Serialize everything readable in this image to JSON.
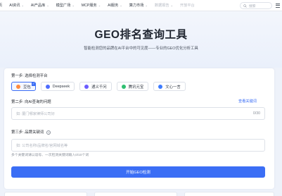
{
  "nav": {
    "items": [
      {
        "label": "页",
        "has_menu": false,
        "faded": false
      },
      {
        "label": "AI资讯",
        "has_menu": true,
        "faded": false
      },
      {
        "label": "AI产品库",
        "has_menu": true,
        "faded": false
      },
      {
        "label": "模型广场",
        "has_menu": true,
        "faded": false
      },
      {
        "label": "MCP服务",
        "has_menu": true,
        "faded": false
      },
      {
        "label": "AI服务",
        "has_menu": true,
        "faded": false
      },
      {
        "label": "算力市场",
        "has_menu": true,
        "faded": false
      },
      {
        "label": "数据报告",
        "has_menu": true,
        "faded": true
      },
      {
        "label": "开放平台",
        "has_menu": false,
        "faded": true
      }
    ],
    "search_placeholder": "搜索"
  },
  "hero": {
    "title": "GEO排名查询工具",
    "subtitle": "智能检测您的品牌在AI平台中的可见度——专业的GEO优化分析工具"
  },
  "form": {
    "step1_label": "第一步: 选择检测平台",
    "platforms": [
      {
        "label": "豆包",
        "selected": true,
        "color": "#ff8a3d"
      },
      {
        "label": "Deepseek",
        "selected": false,
        "color": "#4d6bfe"
      },
      {
        "label": "通义千问",
        "selected": false,
        "color": "#6b5cff"
      },
      {
        "label": "腾讯元宝",
        "selected": false,
        "color": "#2fbf71"
      },
      {
        "label": "文心一言",
        "selected": false,
        "color": "#3d7bff"
      }
    ],
    "step2_label": "第二步: 向AI查询的问题",
    "example_link": "查看关键词",
    "question_placeholder": "如: 厦门哪家律师公司好",
    "question_counter": "0/30",
    "step3_label": "第三步: 品牌关键词",
    "brand_placeholder": "如: 公司名称/品牌名/官网域名等",
    "hint": "多个关键词请以逗号、一次检测关键词输入0/10个词",
    "submit_label": "开始GEO检测"
  },
  "colors": {
    "accent": "#3b6ef5",
    "background": "#eef2fa"
  }
}
